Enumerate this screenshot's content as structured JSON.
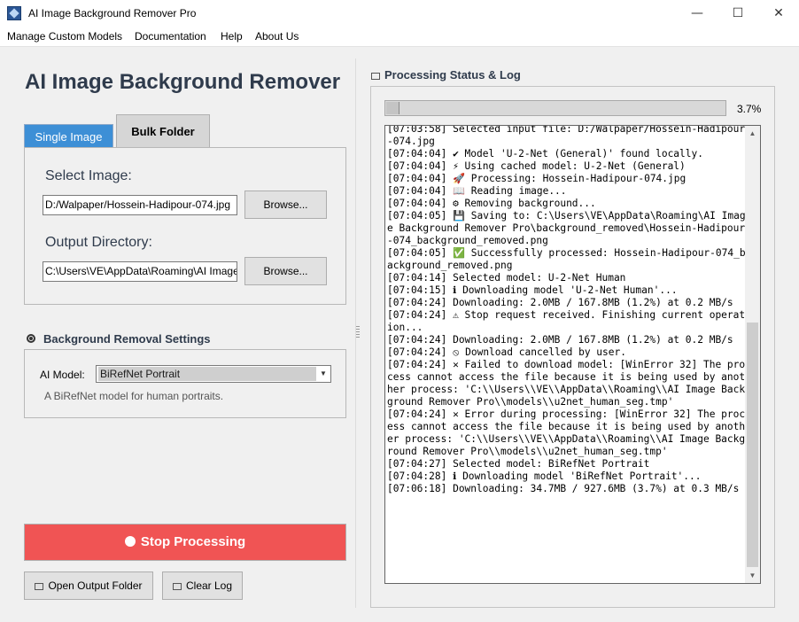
{
  "window": {
    "title": "AI Image Background Remover Pro",
    "controls": {
      "minimize": "—",
      "maximize": "☐",
      "close": "✕"
    }
  },
  "menu": [
    "Manage Custom Models",
    "Documentation",
    "Help",
    "About Us"
  ],
  "heading": "AI Image Background Remover",
  "tabs": {
    "single": "Single Image",
    "bulk": "Bulk Folder"
  },
  "single_image": {
    "select_label": "Select Image:",
    "image_path": "D:/Walpaper/Hossein-Hadipour-074.jpg",
    "browse_label": "Browse...",
    "output_label": "Output Directory:",
    "output_path": "C:\\Users\\VE\\AppData\\Roaming\\AI Image Background Remover Pro\\background_removed"
  },
  "settings": {
    "title": "Background Removal Settings",
    "model_label": "AI Model:",
    "model_value": "BiRefNet Portrait",
    "model_description": "A BiRefNet model for human portraits."
  },
  "actions": {
    "stop": "Stop Processing",
    "open_folder": "Open Output Folder",
    "clear_log": "Clear Log"
  },
  "status": {
    "title": "Processing Status & Log",
    "progress_fraction": 0.037,
    "progress_text": "3.7%"
  },
  "log": [
    "[07:03:58] Selected input file: D:/Walpaper/Hossein-Hadipour-074.jpg",
    "[07:04:04] ✔ Model 'U-2-Net (General)' found locally.",
    "[07:04:04] ⚡ Using cached model: U-2-Net (General)",
    "[07:04:04] 🚀 Processing: Hossein-Hadipour-074.jpg",
    "[07:04:04] 📖 Reading image...",
    "[07:04:04] ⚙ Removing background...",
    "[07:04:05] 💾 Saving to: C:\\Users\\VE\\AppData\\Roaming\\AI Image Background Remover Pro\\background_removed\\Hossein-Hadipour-074_background_removed.png",
    "[07:04:05] ✅ Successfully processed: Hossein-Hadipour-074_background_removed.png",
    "[07:04:14] Selected model: U-2-Net Human",
    "[07:04:15] ℹ Downloading model 'U-2-Net Human'...",
    "[07:04:24] Downloading: 2.0MB / 167.8MB (1.2%) at 0.2 MB/s",
    "[07:04:24] ⚠ Stop request received. Finishing current operation...",
    "[07:04:24] Downloading: 2.0MB / 167.8MB (1.2%) at 0.2 MB/s",
    "[07:04:24] ⦸ Download cancelled by user.",
    "[07:04:24] ✕ Failed to download model: [WinError 32] The process cannot access the file because it is being used by another process: 'C:\\\\Users\\\\VE\\\\AppData\\\\Roaming\\\\AI Image Background Remover Pro\\\\models\\\\u2net_human_seg.tmp'",
    "[07:04:24] ✕ Error during processing: [WinError 32] The process cannot access the file because it is being used by another process: 'C:\\\\Users\\\\VE\\\\AppData\\\\Roaming\\\\AI Image Background Remover Pro\\\\models\\\\u2net_human_seg.tmp'",
    "[07:04:27] Selected model: BiRefNet Portrait",
    "[07:04:28] ℹ Downloading model 'BiRefNet Portrait'...",
    "[07:06:18] Downloading: 34.7MB / 927.6MB (3.7%) at 0.3 MB/s"
  ],
  "colors": {
    "stop_button": "#f05454",
    "active_tab": "#3d8fd6",
    "heading": "#2f3b4c"
  }
}
